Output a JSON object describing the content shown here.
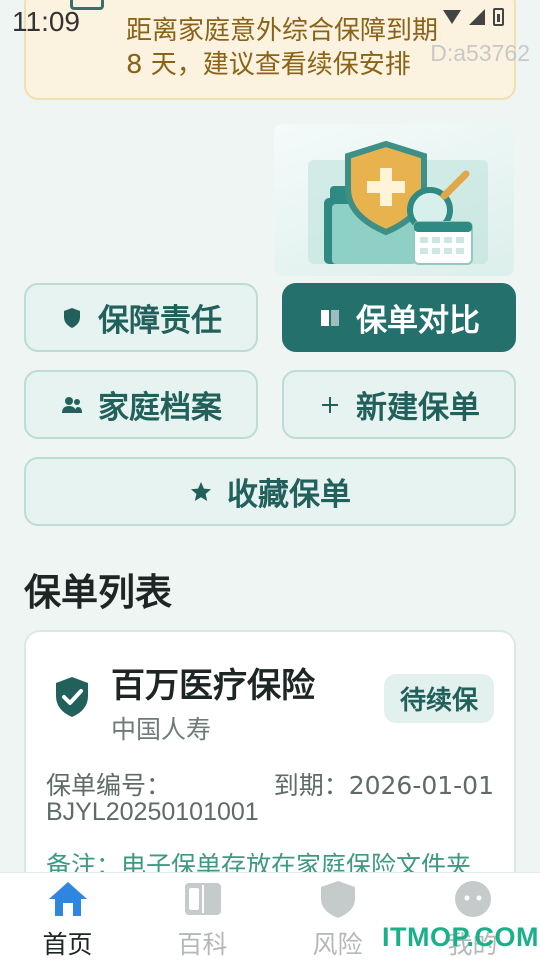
{
  "status_bar": {
    "time": "11:09"
  },
  "watermark_id": "D:a53762",
  "reminder": {
    "line1": "距离家庭意外综合保障到期",
    "line2": "8 天，建议查看续保安排"
  },
  "actions": {
    "coverage": "保障责任",
    "compare": "保单对比",
    "family": "家庭档案",
    "new_policy": "新建保单",
    "favorites": "收藏保单"
  },
  "policy_list": {
    "title": "保单列表",
    "items": [
      {
        "name": "百万医疗保险",
        "company": "中国人寿",
        "status": "待续保",
        "number_label": "保单编号：",
        "number": "BJYL20250101001",
        "due": "到期：2026-01-01",
        "note": "备注：电子保单存放在家庭保险文件夹"
      }
    ]
  },
  "nav": {
    "home": "首页",
    "wiki": "百科",
    "risk": "风险",
    "mine": "我的"
  },
  "site_watermark": "ITMOP.COM",
  "colors": {
    "primary": "#24706c",
    "accent": "#1bb08a",
    "warning_bg": "#fbf3df",
    "warning_text": "#8a6318"
  }
}
